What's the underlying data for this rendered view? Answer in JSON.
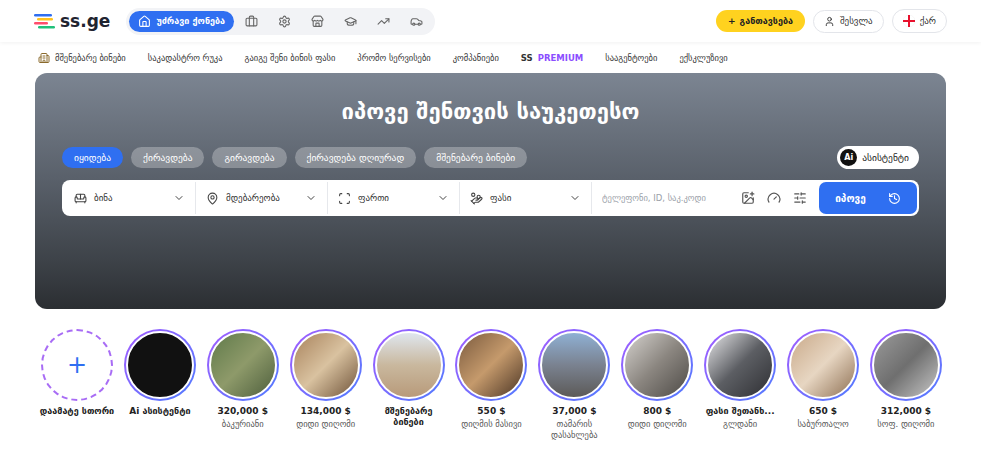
{
  "header": {
    "logo": "ss.ge",
    "categories": [
      {
        "kind": "realestate",
        "label": "უძრავი ქონება",
        "selected": true
      },
      {
        "kind": "jobs",
        "selected": false
      },
      {
        "kind": "services",
        "selected": false
      },
      {
        "kind": "shops",
        "selected": false
      },
      {
        "kind": "education",
        "selected": false
      },
      {
        "kind": "finance",
        "selected": false
      },
      {
        "kind": "cars",
        "selected": false
      }
    ],
    "post_button": {
      "icon": "+",
      "label": "განთავსება"
    },
    "login_button": {
      "label": "შესვლა"
    },
    "language": {
      "label": "ქარ"
    }
  },
  "subnav": {
    "items": [
      {
        "label": "მშენებარე ბინები",
        "kind": "building"
      },
      {
        "label": "საკადასტრო რუკა",
        "kind": "plain"
      },
      {
        "label": "გაიგე შენი ბინის ფასი",
        "kind": "plain"
      },
      {
        "label": "პრომო სერვისები",
        "kind": "plain"
      },
      {
        "label": "კომპანიები",
        "kind": "plain"
      },
      {
        "label": "SS",
        "accent": "PREMIUM",
        "kind": "premium"
      },
      {
        "label": "სააგენტოები",
        "kind": "plain"
      },
      {
        "label": "ექსკლუზივი",
        "kind": "plain"
      }
    ]
  },
  "hero": {
    "title": "იპოვე შენთვის საუკეთესო",
    "tabs": [
      {
        "label": "იყიდება",
        "selected": true
      },
      {
        "label": "ქირავდება",
        "selected": false
      },
      {
        "label": "გირავდება",
        "selected": false
      },
      {
        "label": "ქირავდება დღიურად",
        "selected": false
      },
      {
        "label": "მშენებარე ბინები",
        "selected": false
      }
    ],
    "assistant": {
      "badge": "Ai",
      "label": "ასისტენტი"
    },
    "search": {
      "fields": [
        {
          "kind": "property",
          "label": "ბინა"
        },
        {
          "kind": "location",
          "label": "მდებარეობა"
        },
        {
          "kind": "area",
          "label": "ფართი"
        },
        {
          "kind": "price",
          "label": "ფასი"
        }
      ],
      "placeholder": "ტელეფონი, ID, საკ.კოდი",
      "button": "იპოვე"
    }
  },
  "stories": [
    {
      "kind": "add",
      "icon": "+",
      "title": "დაამატე სთორი"
    },
    {
      "kind": "photo",
      "title": "Ai ასისტენტი"
    },
    {
      "kind": "photo",
      "title": "320,000 $",
      "subtitle": "ბაკურიანი"
    },
    {
      "kind": "photo",
      "title": "134,000 $",
      "subtitle": "დიდი დიღომი"
    },
    {
      "kind": "photo",
      "title": "მშენებარე ბინები"
    },
    {
      "kind": "photo",
      "title": "550 $",
      "subtitle": "დიღმის მასივი"
    },
    {
      "kind": "photo",
      "title": "37,000 $",
      "subtitle": "თამარის დასახლება"
    },
    {
      "kind": "photo",
      "title": "800 $",
      "subtitle": "დიდი დიღომი"
    },
    {
      "kind": "photo",
      "title": "ფასი შეთანხ...",
      "subtitle": "გლდანი"
    },
    {
      "kind": "photo",
      "title": "650 $",
      "subtitle": "საბურთალო"
    },
    {
      "kind": "photo",
      "title": "312,000 $",
      "subtitle": "სოფ. დიღომი"
    }
  ]
}
